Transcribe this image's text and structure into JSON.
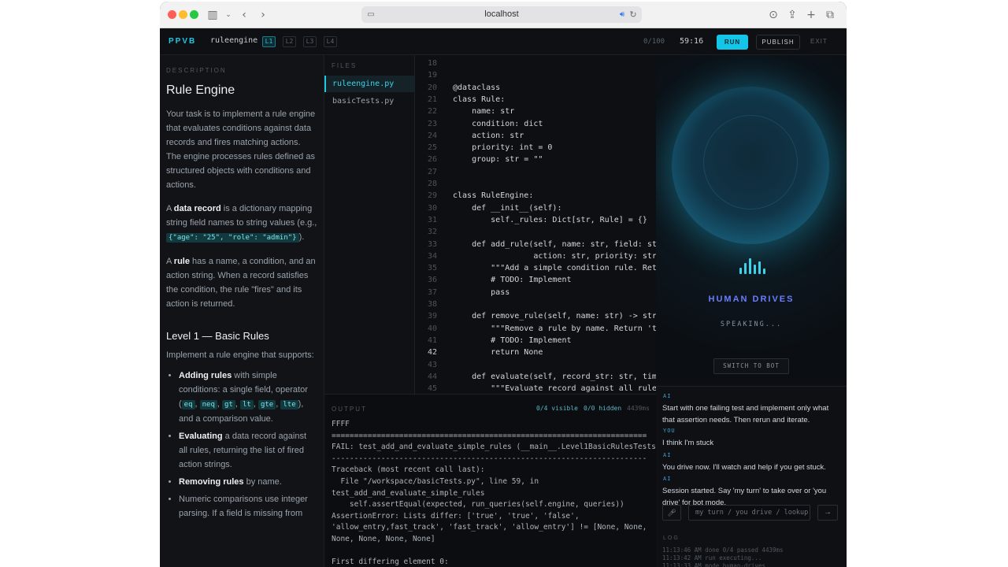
{
  "browser": {
    "url": "localhost"
  },
  "app": {
    "brand": "PPVB",
    "project": "ruleengine",
    "levels": [
      "L1",
      "L2",
      "L3",
      "L4"
    ],
    "score": "0/100",
    "timer": "59:16",
    "run": "RUN",
    "publish": "PUBLISH",
    "exit": "EXIT"
  },
  "description": {
    "label": "DESCRIPTION",
    "title": "Rule Engine",
    "intro": "Your task is to implement a rule engine that evaluates conditions against data records and fires matching actions. The engine processes rules defined as structured objects with conditions and actions.",
    "record_a": "A ",
    "record_b": "data record",
    "record_c": " is a dictionary mapping string field names to string values (e.g., ",
    "record_code": "{\"age\": \"25\", \"role\": \"admin\"}",
    "record_d": ").",
    "rule_a": "A ",
    "rule_b": "rule",
    "rule_c": " has a name, a condition, and an action string. When a record satisfies the condition, the rule \"fires\" and its action is returned.",
    "level_title": "Level 1 — Basic Rules",
    "level_intro": "Implement a rule engine that supports:",
    "li1_b": "Adding rules",
    "li1_a": " with simple conditions: a single field, operator (",
    "ops": [
      "eq",
      "neq",
      "gt",
      "lt",
      "gte",
      "lte"
    ],
    "li1_c": "), and a comparison value.",
    "li2_b": "Evaluating",
    "li2_a": " a data record against all rules, returning the list of fired action strings.",
    "li3_b": "Removing rules",
    "li3_a": " by name.",
    "li4": "Numeric comparisons use integer parsing. If a field is missing from"
  },
  "files": {
    "label": "FILES",
    "items": [
      "ruleengine.py",
      "basicTests.py"
    ]
  },
  "editor": {
    "current_line": 42,
    "lines": [
      {
        "n": 18,
        "t": ""
      },
      {
        "n": 19,
        "t": ""
      },
      {
        "n": 20,
        "t": "@dataclass"
      },
      {
        "n": 21,
        "t": "class Rule:"
      },
      {
        "n": 22,
        "t": "    name: str"
      },
      {
        "n": 23,
        "t": "    condition: dict"
      },
      {
        "n": 24,
        "t": "    action: str"
      },
      {
        "n": 25,
        "t": "    priority: int = 0"
      },
      {
        "n": 26,
        "t": "    group: str = \"\""
      },
      {
        "n": 27,
        "t": ""
      },
      {
        "n": 28,
        "t": ""
      },
      {
        "n": 29,
        "t": "class RuleEngine:"
      },
      {
        "n": 30,
        "t": "    def __init__(self):"
      },
      {
        "n": 31,
        "t": "        self._rules: Dict[str, Rule] = {}"
      },
      {
        "n": 32,
        "t": ""
      },
      {
        "n": 33,
        "t": "    def add_rule(self, name: str, field: str"
      },
      {
        "n": 34,
        "t": "                 action: str, priority: str"
      },
      {
        "n": 35,
        "t": "        \"\"\"Add a simple condition rule. Retu"
      },
      {
        "n": 36,
        "t": "        # TODO: Implement"
      },
      {
        "n": 37,
        "t": "        pass"
      },
      {
        "n": 38,
        "t": ""
      },
      {
        "n": 39,
        "t": "    def remove_rule(self, name: str) -> str"
      },
      {
        "n": 40,
        "t": "        \"\"\"Remove a rule by name. Return 'tr"
      },
      {
        "n": 41,
        "t": "        # TODO: Implement"
      },
      {
        "n": 42,
        "t": "        return None"
      },
      {
        "n": 43,
        "t": ""
      },
      {
        "n": 44,
        "t": "    def evaluate(self, record_str: str, time"
      },
      {
        "n": 45,
        "t": "        \"\"\"Evaluate record against all rules"
      }
    ]
  },
  "output": {
    "label": "OUTPUT",
    "visible": "0/4 visible",
    "hidden": "0/0 hidden",
    "ms": "4439ms",
    "lines": [
      "FFFF",
      "======================================================================",
      "FAIL: test_add_and_evaluate_simple_rules (__main__.Level1BasicRulesTests)",
      "----------------------------------------------------------------------",
      "Traceback (most recent call last):",
      "  File \"/workspace/basicTests.py\", line 59, in",
      "test_add_and_evaluate_simple_rules",
      "    self.assertEqual(expected, run_queries(self.engine, queries))",
      "AssertionError: Lists differ: ['true', 'true', 'false',",
      "'allow_entry,fast_track', 'fast_track', 'allow_entry'] != [None, None,",
      "None, None, None, None]",
      "",
      "First differing element 0:"
    ]
  },
  "voice": {
    "mode": "HUMAN DRIVES",
    "status": "SPEAKING...",
    "switch": "SWITCH TO BOT"
  },
  "chat": {
    "messages": [
      {
        "who": "AI",
        "text": "Start with one failing test and implement only what that assertion needs. Then rerun and iterate."
      },
      {
        "who": "YOU",
        "text": "I think I'm stuck"
      },
      {
        "who": "AI",
        "text": "You drive now. I'll watch and help if you get stuck."
      },
      {
        "who": "AI",
        "text": "Session started. Say 'my turn' to take over or 'you drive' for bot mode."
      }
    ],
    "placeholder": "my turn / you drive / lookup",
    "send": "→"
  },
  "log": {
    "label": "LOG",
    "lines": [
      "11:13:46 AM done 0/4 passed 4439ms",
      "11:13:42 AM run executing...",
      "11:13:33 AM mode human-drives"
    ]
  },
  "colors": {
    "accent": "#22c7e6",
    "mode": "#6b7cff",
    "background": "#0d0f12"
  }
}
